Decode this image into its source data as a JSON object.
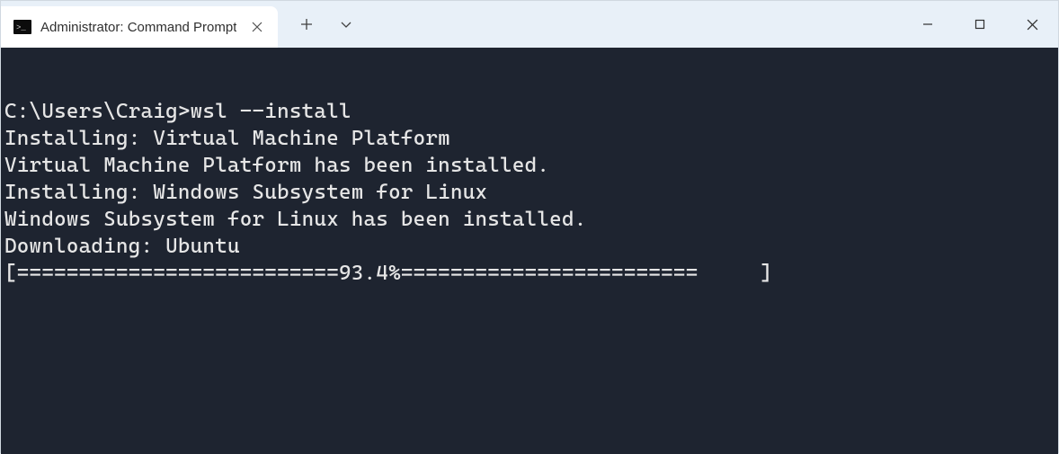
{
  "tab": {
    "title": "Administrator: Command Prompt",
    "icon": "cmd-icon"
  },
  "terminal": {
    "lines": [
      "",
      "C:\\Users\\Craig>wsl --install",
      "Installing: Virtual Machine Platform",
      "Virtual Machine Platform has been installed.",
      "Installing: Windows Subsystem for Linux",
      "Windows Subsystem for Linux has been installed.",
      "Downloading: Ubuntu",
      "[==========================93.4%========================     ]"
    ]
  },
  "colors": {
    "terminal_bg": "#1e2430",
    "terminal_fg": "#e6e6e6",
    "titlebar_bg": "#e8f0f8"
  }
}
